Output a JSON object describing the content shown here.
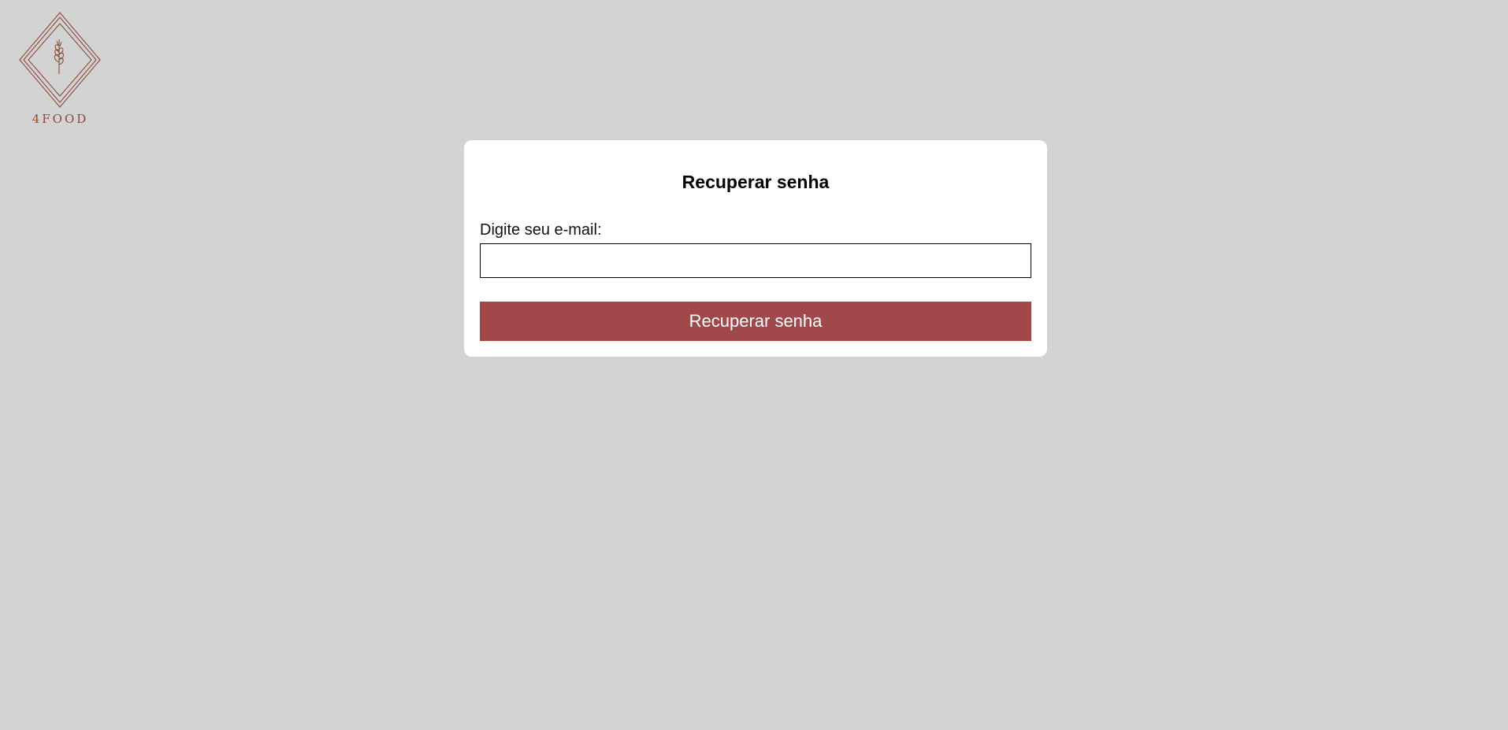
{
  "brand": {
    "name": "4FOOD",
    "logo_icon": "diamond-wheat-logo-icon",
    "color": "#8a4a3a"
  },
  "form": {
    "title": "Recuperar senha",
    "email_label": "Digite seu e-mail:",
    "email_value": "",
    "email_placeholder": "",
    "submit_label": "Recuperar senha"
  },
  "colors": {
    "background": "#d3d3d3",
    "card": "#ffffff",
    "accent": "#a1484a"
  }
}
